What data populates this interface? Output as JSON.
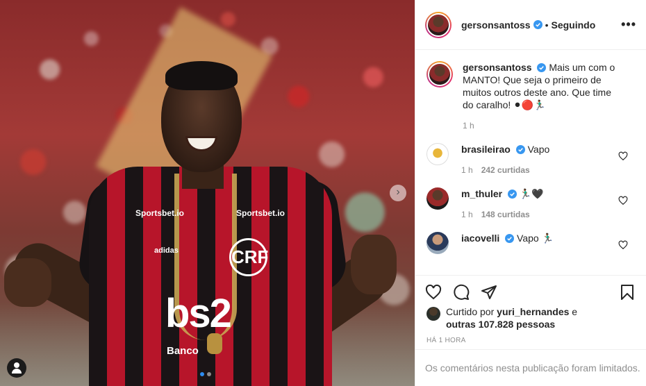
{
  "post": {
    "username": "gersonsantoss",
    "follow_state": "Seguindo",
    "more_label": "•••",
    "caption": "Mais um com o MANTO! Que seja o primeiro de muitos outros deste ano. Que time do caralho! ⚫🔴🏃🏾‍♂️",
    "caption_time": "1 h"
  },
  "photo": {
    "sponsor_left": "Sportsbet.io",
    "sponsor_right": "Sportsbet.io",
    "brand": "adidas",
    "main_sponsor": "bs2",
    "sub_sponsor": "Banco",
    "crest": "CRF"
  },
  "comments": [
    {
      "username": "brasileirao",
      "text": "Vapo",
      "time": "1 h",
      "likes": "242 curtidas",
      "avatar_color": "#f2f2f2"
    },
    {
      "username": "m_thuler",
      "text": "🏃🏾‍♂️🖤",
      "time": "1 h",
      "likes": "148 curtidas",
      "avatar_color": "#7a2a2a"
    },
    {
      "username": "iacovelli",
      "text": "Vapo 🏃🏾‍♂️",
      "time": "",
      "likes": "",
      "avatar_color": "#2a2f3a"
    }
  ],
  "likes": {
    "prefix": "Curtido por ",
    "user": "yuri_hernandes",
    "middle": " e",
    "others": "outras 107.828 pessoas"
  },
  "time_ago": "HÁ 1 HORA",
  "comments_limited": "Os comentários nesta publicação foram limitados.",
  "colors": {
    "verified": "#3897f0",
    "muted": "#8e8e8e",
    "text": "#262626",
    "divider": "#efefef"
  },
  "icons": [
    "verified-badge-icon",
    "more-options-icon",
    "heart-icon",
    "comment-icon",
    "share-icon",
    "bookmark-icon",
    "carousel-next-icon",
    "tagged-user-icon"
  ]
}
